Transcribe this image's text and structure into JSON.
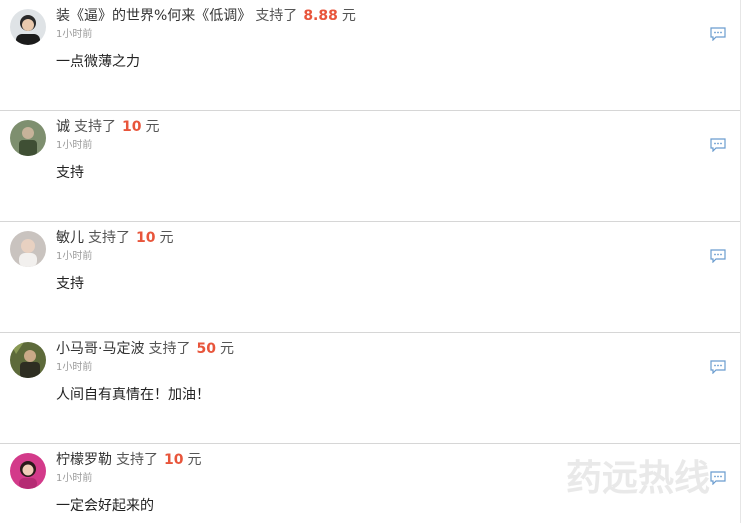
{
  "support_word": "支持了",
  "currency_unit": "元",
  "accent_color": "#e8553b",
  "comment_icon": "comment-bubble-icon",
  "watermark_text": "药远热线",
  "items": [
    {
      "name": "装《逼》的世界%何来《低调》",
      "amount": "8.88",
      "time": "1小时前",
      "message": "一点微薄之力"
    },
    {
      "name": "诚",
      "amount": "10",
      "time": "1小时前",
      "message": "支持"
    },
    {
      "name": "敏儿",
      "amount": "10",
      "time": "1小时前",
      "message": "支持"
    },
    {
      "name": "小马哥·马定波",
      "amount": "50",
      "time": "1小时前",
      "message": "人间自有真情在！加油！"
    },
    {
      "name": "柠檬罗勒",
      "amount": "10",
      "time": "1小时前",
      "message": "一定会好起来的"
    }
  ]
}
